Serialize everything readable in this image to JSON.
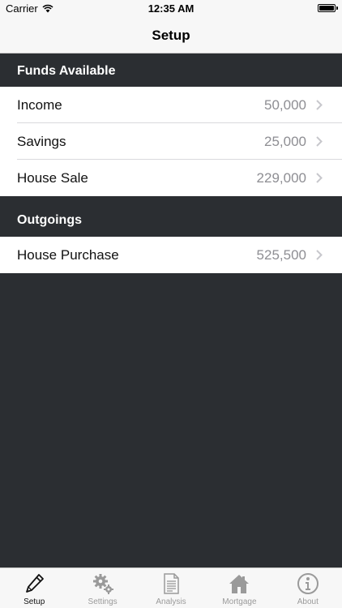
{
  "status": {
    "carrier": "Carrier",
    "time": "12:35 AM"
  },
  "nav": {
    "title": "Setup"
  },
  "sections": [
    {
      "header": "Funds Available",
      "rows": [
        {
          "label": "Income",
          "value": "50,000"
        },
        {
          "label": "Savings",
          "value": "25,000"
        },
        {
          "label": "House Sale",
          "value": "229,000"
        }
      ]
    },
    {
      "header": "Outgoings",
      "rows": [
        {
          "label": "House Purchase",
          "value": "525,500"
        }
      ]
    }
  ],
  "tabs": [
    {
      "label": "Setup",
      "icon": "pencil-icon",
      "active": true
    },
    {
      "label": "Settings",
      "icon": "gears-icon",
      "active": false
    },
    {
      "label": "Analysis",
      "icon": "document-icon",
      "active": false
    },
    {
      "label": "Mortgage",
      "icon": "house-icon",
      "active": false
    },
    {
      "label": "About",
      "icon": "info-icon",
      "active": false
    }
  ],
  "colors": {
    "background": "#2b2e32",
    "bars": "#f7f7f7",
    "value_text": "#8e8e93",
    "inactive_tab": "#9a9a9a"
  }
}
